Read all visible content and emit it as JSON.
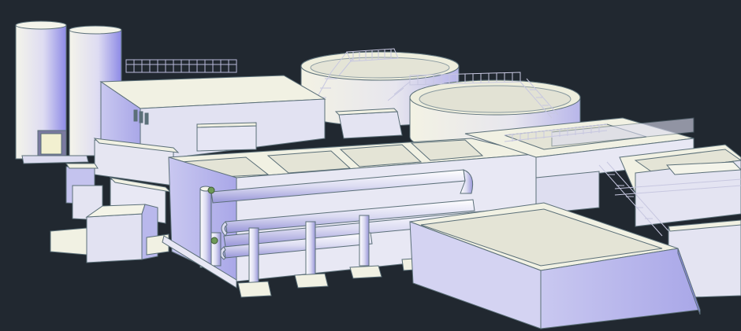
{
  "scene": {
    "background": "#212830",
    "face_light": "#f1f1e3",
    "face_mid": "#dcdcf2",
    "face_shade": "#a9a8e8",
    "edge": "#5b6f78",
    "pipe_light": "#ececf6",
    "pipe_shade": "#9c9bdc",
    "rail": "#b8b8d8",
    "accent_green": "#6e9a58"
  }
}
